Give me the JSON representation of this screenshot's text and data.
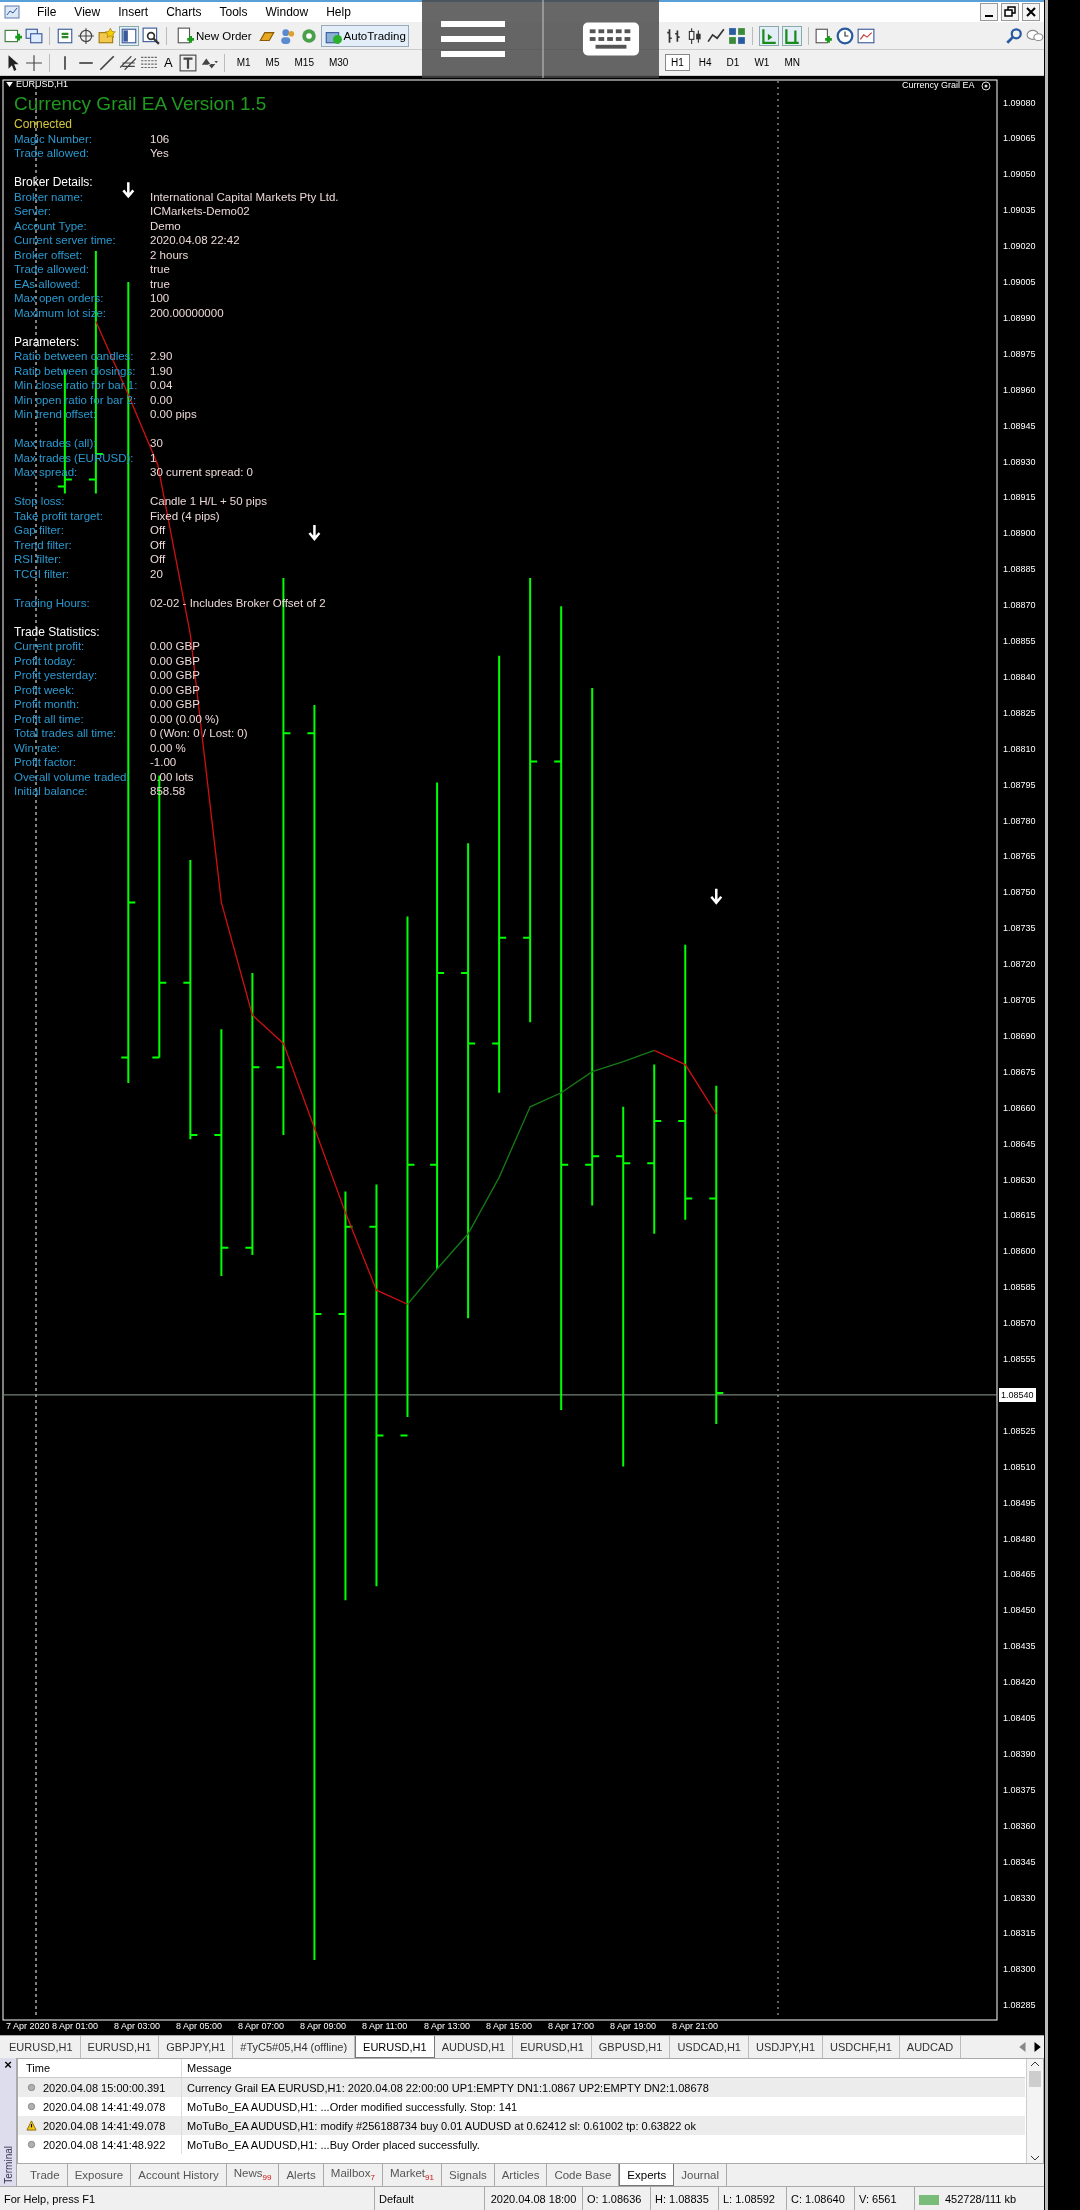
{
  "menu": [
    "File",
    "View",
    "Insert",
    "Charts",
    "Tools",
    "Window",
    "Help"
  ],
  "toolbar": {
    "new_order": "New Order",
    "autotrading": {
      "label": "AutoTrading",
      "on": true
    },
    "text_tool": "A"
  },
  "timeframes": [
    {
      "label": "M1",
      "selected": false
    },
    {
      "label": "M5",
      "selected": false
    },
    {
      "label": "M15",
      "selected": false
    },
    {
      "label": "M30",
      "selected": false
    },
    {
      "label": "H1",
      "selected": true
    },
    {
      "label": "H4",
      "selected": false
    },
    {
      "label": "D1",
      "selected": false
    },
    {
      "label": "W1",
      "selected": false
    },
    {
      "label": "MN",
      "selected": false
    }
  ],
  "chart": {
    "symbol": "EURUSD,H1",
    "ea_label": "Currency Grail EA",
    "panel": {
      "title": "Currency Grail EA Version 1.5",
      "status": "Connected",
      "groups": [
        {
          "rows": [
            {
              "label": "Magic Number:",
              "value": "106"
            },
            {
              "label": "Trade allowed:",
              "value": "Yes"
            }
          ]
        },
        {
          "heading": "Broker Details:",
          "rows": [
            {
              "label": "Broker name:",
              "value": "International Capital Markets Pty Ltd."
            },
            {
              "label": "Server:",
              "value": "ICMarkets-Demo02"
            },
            {
              "label": "Account Type:",
              "value": "Demo"
            },
            {
              "label": "Current server time:",
              "value": "2020.04.08 22:42"
            },
            {
              "label": "Broker offset:",
              "value": "2 hours"
            },
            {
              "label": "Trade allowed:",
              "value": "true"
            },
            {
              "label": "EAs allowed:",
              "value": "true"
            },
            {
              "label": "Max open orders:",
              "value": "100"
            },
            {
              "label": "Maximum lot size:",
              "value": "200.00000000"
            }
          ]
        },
        {
          "heading": "Parameters:",
          "rows": [
            {
              "label": "Ratio between candles:",
              "value": "2.90"
            },
            {
              "label": "Ratio between closings:",
              "value": "1.90"
            },
            {
              "label": "Min close ratio for bar 1:",
              "value": "0.04"
            },
            {
              "label": "Min open ratio for bar 2:",
              "value": "0.00"
            },
            {
              "label": "Min trend offset:",
              "value": "0.00 pips"
            }
          ]
        },
        {
          "rows": [
            {
              "label": "Max trades (all):",
              "value": "30"
            },
            {
              "label": "Max trades (EURUSD):",
              "value": "1"
            },
            {
              "label": "Max spread:",
              "value": "30 current spread: 0"
            }
          ]
        },
        {
          "rows": [
            {
              "label": "Stop loss:",
              "value": "Candle 1 H/L + 50 pips"
            },
            {
              "label": "Take profit target:",
              "value": "Fixed (4 pips)"
            },
            {
              "label": "Gap filter:",
              "value": "Off"
            },
            {
              "label": "Trend filter:",
              "value": "Off"
            },
            {
              "label": "RSI filter:",
              "value": "Off"
            },
            {
              "label": "TCCI filter:",
              "value": "20"
            }
          ]
        },
        {
          "rows": [
            {
              "label": "Trading Hours:",
              "value": "02-02 - Includes Broker Offset of 2"
            }
          ]
        },
        {
          "heading": "Trade Statistics:",
          "rows": [
            {
              "label": "Current profit:",
              "value": "0.00 GBP"
            },
            {
              "label": "Profit today:",
              "value": "0.00 GBP"
            },
            {
              "label": "Profit yesterday:",
              "value": "0.00 GBP"
            },
            {
              "label": "Profit week:",
              "value": "0.00 GBP"
            },
            {
              "label": "Profit month:",
              "value": "0.00 GBP"
            },
            {
              "label": "Profit all time:",
              "value": "0.00 (0.00 %)"
            },
            {
              "label": "Total trades all time:",
              "value": "0 (Won: 0 / Lost: 0)"
            },
            {
              "label": "Win rate:",
              "value": "0.00 %"
            },
            {
              "label": "Profit factor:",
              "value": "-1.00"
            },
            {
              "label": "Overall volume traded:",
              "value": "0.00 lots"
            },
            {
              "label": "Initial balance:",
              "value": "858.58"
            }
          ]
        }
      ]
    },
    "price_ticks": [
      {
        "label": "1.09080",
        "current": false
      },
      {
        "label": "1.09065",
        "current": false
      },
      {
        "label": "1.09050",
        "current": false
      },
      {
        "label": "1.09035",
        "current": false
      },
      {
        "label": "1.09020",
        "current": false
      },
      {
        "label": "1.09005",
        "current": false
      },
      {
        "label": "1.08990",
        "current": false
      },
      {
        "label": "1.08975",
        "current": false
      },
      {
        "label": "1.08960",
        "current": false
      },
      {
        "label": "1.08945",
        "current": false
      },
      {
        "label": "1.08930",
        "current": false
      },
      {
        "label": "1.08915",
        "current": false
      },
      {
        "label": "1.08900",
        "current": false
      },
      {
        "label": "1.08885",
        "current": false
      },
      {
        "label": "1.08870",
        "current": false
      },
      {
        "label": "1.08855",
        "current": false
      },
      {
        "label": "1.08840",
        "current": false
      },
      {
        "label": "1.08825",
        "current": false
      },
      {
        "label": "1.08810",
        "current": false
      },
      {
        "label": "1.08795",
        "current": false
      },
      {
        "label": "1.08780",
        "current": false
      },
      {
        "label": "1.08765",
        "current": false
      },
      {
        "label": "1.08750",
        "current": false
      },
      {
        "label": "1.08735",
        "current": false
      },
      {
        "label": "1.08720",
        "current": false
      },
      {
        "label": "1.08705",
        "current": false
      },
      {
        "label": "1.08690",
        "current": false
      },
      {
        "label": "1.08675",
        "current": false
      },
      {
        "label": "1.08660",
        "current": false
      },
      {
        "label": "1.08645",
        "current": false
      },
      {
        "label": "1.08630",
        "current": false
      },
      {
        "label": "1.08615",
        "current": false
      },
      {
        "label": "1.08600",
        "current": false
      },
      {
        "label": "1.08585",
        "current": false
      },
      {
        "label": "1.08570",
        "current": false
      },
      {
        "label": "1.08555",
        "current": false
      },
      {
        "label": "1.08540",
        "current": true
      },
      {
        "label": "1.08525",
        "current": false
      },
      {
        "label": "1.08510",
        "current": false
      },
      {
        "label": "1.08495",
        "current": false
      },
      {
        "label": "1.08480",
        "current": false
      },
      {
        "label": "1.08465",
        "current": false
      },
      {
        "label": "1.08450",
        "current": false
      },
      {
        "label": "1.08435",
        "current": false
      },
      {
        "label": "1.08420",
        "current": false
      },
      {
        "label": "1.08405",
        "current": false
      },
      {
        "label": "1.08390",
        "current": false
      },
      {
        "label": "1.08375",
        "current": false
      },
      {
        "label": "1.08360",
        "current": false
      },
      {
        "label": "1.08345",
        "current": false
      },
      {
        "label": "1.08330",
        "current": false
      },
      {
        "label": "1.08315",
        "current": false
      },
      {
        "label": "1.08300",
        "current": false
      },
      {
        "label": "1.08285",
        "current": false
      }
    ],
    "time_labels": [
      "7 Apr 2020",
      "8 Apr 01:00",
      "8 Apr 03:00",
      "8 Apr 05:00",
      "8 Apr 07:00",
      "8 Apr 09:00",
      "8 Apr 11:00",
      "8 Apr 13:00",
      "8 Apr 15:00",
      "8 Apr 17:00",
      "8 Apr 19:00",
      "8 Apr 21:00"
    ]
  },
  "chart_tabs": [
    {
      "label": "EURUSD,H1",
      "selected": false
    },
    {
      "label": "EURUSD,H1",
      "selected": false
    },
    {
      "label": "GBPJPY,H1",
      "selected": false
    },
    {
      "label": "#TyC5#05,H4 (offline)",
      "selected": false
    },
    {
      "label": "EURUSD,H1",
      "selected": true
    },
    {
      "label": "AUDUSD,H1",
      "selected": false
    },
    {
      "label": "EURUSD,H1",
      "selected": false
    },
    {
      "label": "GBPUSD,H1",
      "selected": false
    },
    {
      "label": "USDCAD,H1",
      "selected": false
    },
    {
      "label": "USDJPY,H1",
      "selected": false
    },
    {
      "label": "USDCHF,H1",
      "selected": false
    },
    {
      "label": "AUDCAD",
      "selected": false
    }
  ],
  "terminal": {
    "close": "×",
    "label": "Terminal",
    "columns": [
      "Time",
      "Message"
    ],
    "rows": [
      {
        "kind": "info",
        "time": "2020.04.08 15:00:00.391",
        "message": "Currency Grail EA EURUSD,H1: 2020.04.08 22:00:00 UP1:EMPTY DN1:1.0867  UP2:EMPTY DN2:1.08678"
      },
      {
        "kind": "info",
        "time": "2020.04.08 14:41:49.078",
        "message": "MoTuBo_EA AUDUSD,H1: ...Order modified successfully. Stop: 141"
      },
      {
        "kind": "warning",
        "time": "2020.04.08 14:41:49.078",
        "message": "MoTuBo_EA AUDUSD,H1: modify #256188734 buy 0.01 AUDUSD at 0.62412 sl: 0.61002 tp: 0.63822 ok"
      },
      {
        "kind": "info",
        "time": "2020.04.08 14:41:48.922",
        "message": "MoTuBo_EA AUDUSD,H1: ...Buy Order placed successfully."
      }
    ],
    "tabs": [
      {
        "label": "Trade",
        "selected": false
      },
      {
        "label": "Exposure",
        "selected": false
      },
      {
        "label": "Account History",
        "selected": false
      },
      {
        "label": "News",
        "badge": "99",
        "selected": false
      },
      {
        "label": "Alerts",
        "selected": false
      },
      {
        "label": "Mailbox",
        "badge": "7",
        "selected": false
      },
      {
        "label": "Market",
        "badge": "91",
        "selected": false
      },
      {
        "label": "Signals",
        "selected": false
      },
      {
        "label": "Articles",
        "selected": false
      },
      {
        "label": "Code Base",
        "selected": false
      },
      {
        "label": "Experts",
        "selected": true
      },
      {
        "label": "Journal",
        "selected": false
      }
    ]
  },
  "status_bar": {
    "help": "For Help, press F1",
    "profile": "Default",
    "time": "2020.04.08 18:00",
    "open": "O: 1.08636",
    "high": "H: 1.08835",
    "low": "L: 1.08592",
    "close": "C: 1.08640",
    "volume": "V: 6561",
    "traffic": "452728/111 kb"
  }
}
